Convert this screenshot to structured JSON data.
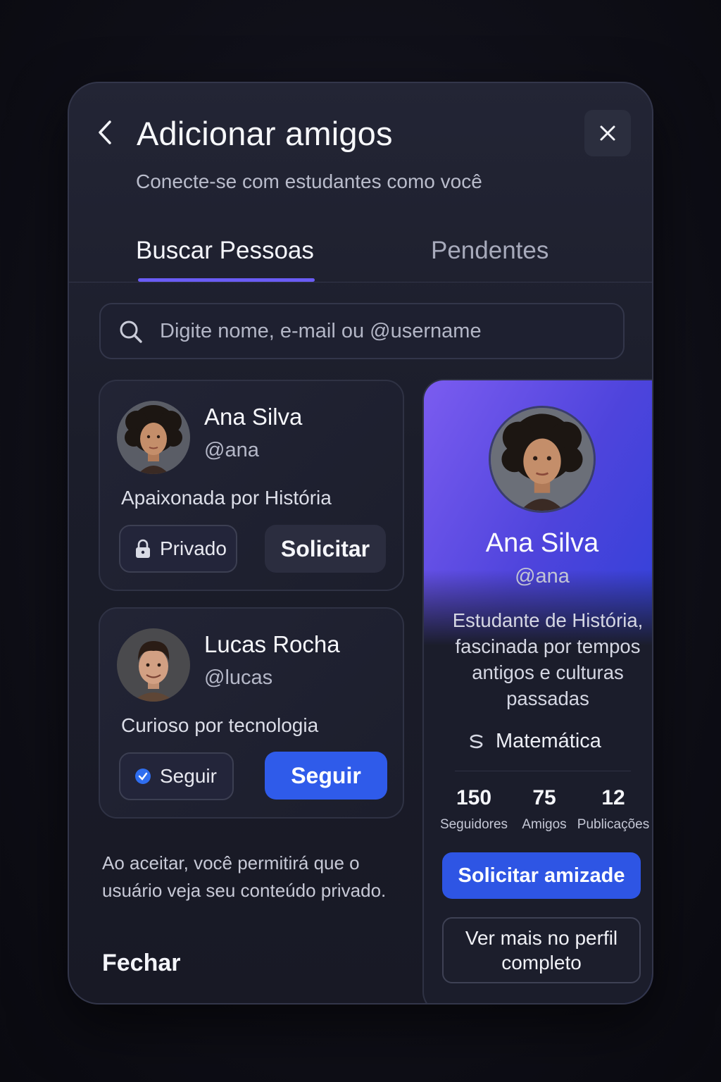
{
  "header": {
    "title": "Adicionar amigos",
    "subtitle": "Conecte-se com estudantes como você"
  },
  "tabs": [
    {
      "label": "Buscar Pessoas",
      "active": true
    },
    {
      "label": "Pendentes",
      "active": false
    }
  ],
  "search": {
    "placeholder": "Digite nome, e-mail ou @username",
    "value": ""
  },
  "results": [
    {
      "name": "Ana Silva",
      "handle": "@ana",
      "bio": "Apaixonada por História",
      "status_chip": "Privado",
      "status_icon": "lock-icon",
      "action": "Solicitar"
    },
    {
      "name": "Lucas Rocha",
      "handle": "@lucas",
      "bio": "Curioso por tecnologia",
      "status_chip": "Seguir",
      "status_icon": "verified-icon",
      "action": "Seguir"
    }
  ],
  "notice": "Ao aceitar, você permitirá que o usuário veja seu conteúdo privado.",
  "close_label": "Fechar",
  "profile": {
    "name": "Ana Silva",
    "handle": "@ana",
    "bio": "Estudante de História, fascinada por tempos antigos e culturas passadas",
    "subject": "Matemática",
    "stats": [
      {
        "value": "150",
        "label": "Seguidores"
      },
      {
        "value": "75",
        "label": "Amigos"
      },
      {
        "value": "12",
        "label": "Publicações"
      }
    ],
    "primary_action": "Solicitar amizade",
    "secondary_action": "Ver mais no perfil completo"
  },
  "colors": {
    "accent": "#6a5cf5",
    "primary_button": "#2f5bea",
    "background": "#1b1d2a"
  }
}
